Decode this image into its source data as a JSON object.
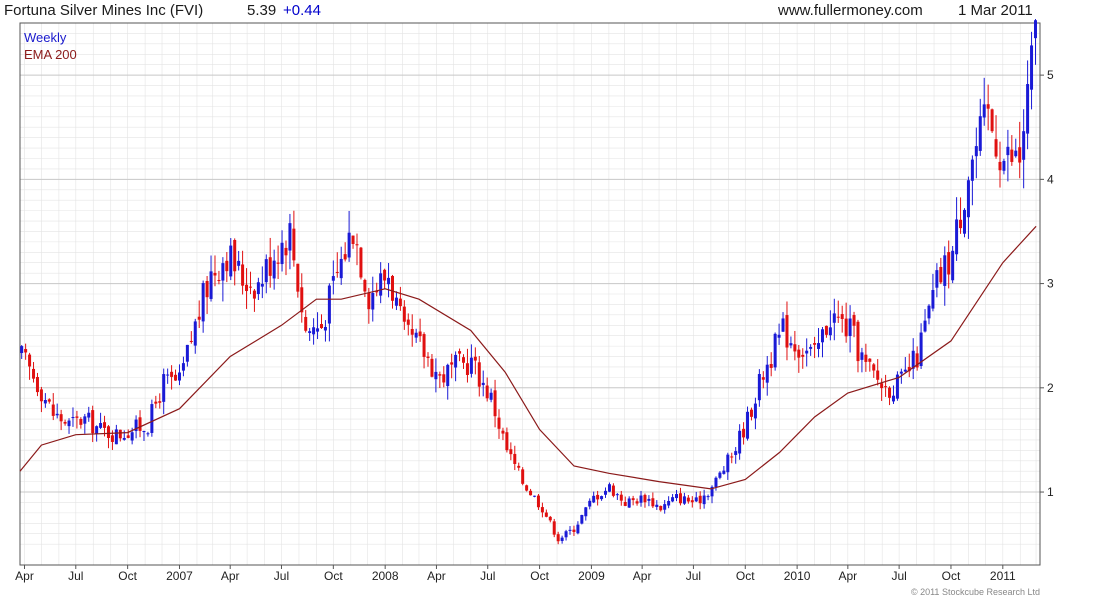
{
  "header": {
    "title": "Fortuna Silver Mines Inc (FVI)",
    "price": "5.39",
    "change": "+0.44",
    "website": "www.fullermoney.com",
    "date": "1 Mar 2011"
  },
  "footer": {
    "copyright": "© 2011 Stockcube Research Ltd"
  },
  "colors": {
    "up": "#1a1ad6",
    "down": "#e01010",
    "ema": "#8b1a1a",
    "grid": "#e4e4e4",
    "legend_weekly": "#1a1acc",
    "legend_ema": "#8b1a1a"
  },
  "chart_data": {
    "type": "candlestick",
    "title": "Fortuna Silver Mines Inc (FVI)",
    "legend": [
      "Weekly",
      "EMA 200"
    ],
    "legend_position": "top-left",
    "y_axis_side": "right",
    "ylim": [
      0.3,
      5.5
    ],
    "yticks": [
      "5",
      "4",
      "3",
      "2",
      "1"
    ],
    "ytick_values": [
      5,
      4,
      3,
      2,
      1
    ],
    "grid": true,
    "xticks": [
      "Apr",
      "Jul",
      "Oct",
      "2007",
      "Apr",
      "Jul",
      "Oct",
      "2008",
      "Apr",
      "Jul",
      "Oct",
      "2009",
      "Apr",
      "Jul",
      "Oct",
      "2010",
      "Apr",
      "Jul",
      "Oct",
      "2011"
    ],
    "xtick_dates": [
      "2006-04-01",
      "2006-07-01",
      "2006-10-01",
      "2007-01-01",
      "2007-04-01",
      "2007-07-01",
      "2007-10-01",
      "2008-01-01",
      "2008-04-01",
      "2008-07-01",
      "2008-10-01",
      "2009-01-01",
      "2009-04-01",
      "2009-07-01",
      "2009-10-01",
      "2010-01-01",
      "2010-04-01",
      "2010-07-01",
      "2010-10-01",
      "2011-01-01"
    ],
    "x_range": [
      "2006-03-24",
      "2011-03-08"
    ],
    "series": [
      {
        "name": "Weekly",
        "type": "close",
        "points": [
          [
            "2006-03-27",
            2.3
          ],
          [
            "2006-04-24",
            2.05
          ],
          [
            "2006-05-22",
            1.75
          ],
          [
            "2006-06-19",
            1.65
          ],
          [
            "2006-07-17",
            1.7
          ],
          [
            "2006-08-14",
            1.6
          ],
          [
            "2006-09-11",
            1.55
          ],
          [
            "2006-10-09",
            1.6
          ],
          [
            "2006-11-06",
            1.65
          ],
          [
            "2006-12-04",
            2.05
          ],
          [
            "2007-01-01",
            2.05
          ],
          [
            "2007-01-29",
            2.6
          ],
          [
            "2007-02-26",
            3.1
          ],
          [
            "2007-03-26",
            3.3
          ],
          [
            "2007-04-23",
            3.05
          ],
          [
            "2007-05-21",
            3.0
          ],
          [
            "2007-06-18",
            3.3
          ],
          [
            "2007-07-16",
            3.5
          ],
          [
            "2007-08-13",
            2.55
          ],
          [
            "2007-09-10",
            2.6
          ],
          [
            "2007-10-08",
            3.1
          ],
          [
            "2007-11-05",
            3.55
          ],
          [
            "2007-12-03",
            2.9
          ],
          [
            "2008-01-07",
            3.1
          ],
          [
            "2008-02-04",
            2.5
          ],
          [
            "2008-03-03",
            2.4
          ],
          [
            "2008-04-07",
            2.1
          ],
          [
            "2008-05-05",
            2.2
          ],
          [
            "2008-06-02",
            2.25
          ],
          [
            "2008-07-07",
            1.9
          ],
          [
            "2008-08-04",
            1.4
          ],
          [
            "2008-09-01",
            1.1
          ],
          [
            "2008-10-06",
            0.85
          ],
          [
            "2008-11-03",
            0.55
          ],
          [
            "2008-12-01",
            0.65
          ],
          [
            "2009-01-05",
            0.95
          ],
          [
            "2009-02-02",
            1.05
          ],
          [
            "2009-03-02",
            0.9
          ],
          [
            "2009-04-06",
            0.95
          ],
          [
            "2009-05-04",
            0.85
          ],
          [
            "2009-06-01",
            0.95
          ],
          [
            "2009-07-06",
            0.9
          ],
          [
            "2009-08-03",
            1.05
          ],
          [
            "2009-09-07",
            1.35
          ],
          [
            "2009-10-05",
            1.7
          ],
          [
            "2009-11-02",
            2.15
          ],
          [
            "2009-12-07",
            2.55
          ],
          [
            "2010-01-04",
            2.4
          ],
          [
            "2010-02-01",
            2.3
          ],
          [
            "2010-03-01",
            2.7
          ],
          [
            "2010-04-05",
            2.55
          ],
          [
            "2010-05-03",
            2.2
          ],
          [
            "2010-06-07",
            2.0
          ],
          [
            "2010-07-05",
            2.05
          ],
          [
            "2010-08-02",
            2.3
          ],
          [
            "2010-09-06",
            3.0
          ],
          [
            "2010-10-04",
            3.3
          ],
          [
            "2010-11-01",
            4.1
          ],
          [
            "2010-12-06",
            4.6
          ],
          [
            "2011-01-03",
            4.2
          ],
          [
            "2011-01-31",
            4.2
          ],
          [
            "2011-02-28",
            5.39
          ]
        ]
      },
      {
        "name": "EMA 200",
        "type": "line",
        "points": [
          [
            "2006-03-24",
            1.2
          ],
          [
            "2006-05-01",
            1.45
          ],
          [
            "2006-07-01",
            1.55
          ],
          [
            "2006-10-01",
            1.57
          ],
          [
            "2007-01-01",
            1.8
          ],
          [
            "2007-04-01",
            2.3
          ],
          [
            "2007-07-01",
            2.6
          ],
          [
            "2007-09-01",
            2.85
          ],
          [
            "2007-10-15",
            2.85
          ],
          [
            "2008-01-01",
            2.95
          ],
          [
            "2008-03-01",
            2.85
          ],
          [
            "2008-06-01",
            2.55
          ],
          [
            "2008-08-01",
            2.15
          ],
          [
            "2008-10-01",
            1.6
          ],
          [
            "2008-12-01",
            1.25
          ],
          [
            "2009-02-01",
            1.18
          ],
          [
            "2009-05-01",
            1.1
          ],
          [
            "2009-08-01",
            1.03
          ],
          [
            "2009-10-01",
            1.12
          ],
          [
            "2009-12-01",
            1.38
          ],
          [
            "2010-02-01",
            1.72
          ],
          [
            "2010-04-01",
            1.95
          ],
          [
            "2010-07-01",
            2.1
          ],
          [
            "2010-10-01",
            2.45
          ],
          [
            "2011-01-01",
            3.2
          ],
          [
            "2011-03-01",
            3.55
          ]
        ]
      }
    ]
  }
}
